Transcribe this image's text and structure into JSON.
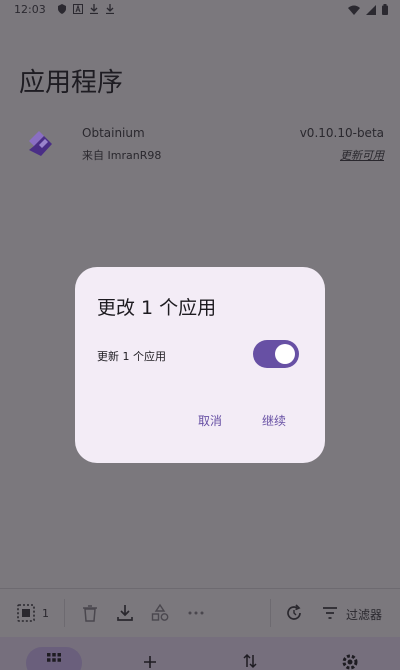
{
  "status_bar": {
    "time": "12:03"
  },
  "page": {
    "title": "应用程序"
  },
  "apps": [
    {
      "name": "Obtainium",
      "source": "来自 ImranR98",
      "version": "v0.10.10-beta",
      "status": "更新可用"
    }
  ],
  "toolbar": {
    "selected_count": "1",
    "filter_label": "过滤器"
  },
  "dialog": {
    "title": "更改 1 个应用",
    "toggle_label": "更新 1 个应用",
    "toggle_on": true,
    "cancel_label": "取消",
    "continue_label": "继续"
  },
  "colors": {
    "accent": "#6750a4",
    "dialog_bg": "#f3ecf6",
    "scrim_bg": "#7b787d"
  },
  "icons": {
    "status": [
      "shield-icon",
      "a-box-icon",
      "download-icon",
      "download-icon",
      "wifi-icon",
      "signal-icon",
      "battery-icon"
    ],
    "toolbar": [
      "select-all-icon",
      "trash-icon",
      "download-icon",
      "categories-icon",
      "more-icon",
      "refresh-icon",
      "filter-icon"
    ],
    "nav": [
      "apps-icon",
      "add-icon",
      "import-export-icon",
      "settings-icon"
    ]
  }
}
